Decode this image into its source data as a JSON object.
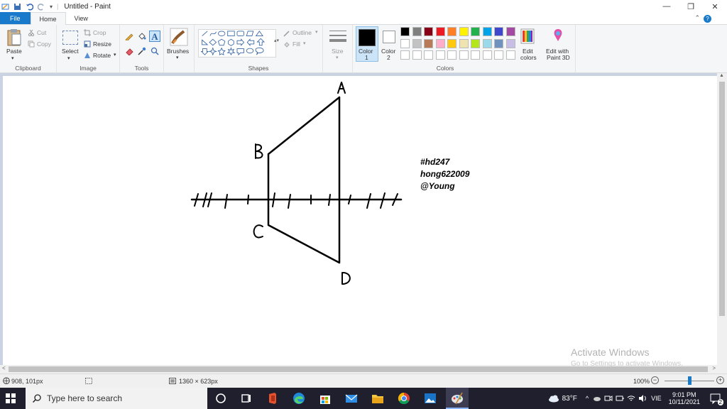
{
  "window": {
    "title": "Untitled - Paint",
    "controls": [
      "minimize",
      "maximize",
      "close"
    ]
  },
  "tabs": {
    "file": "File",
    "home": "Home",
    "view": "View"
  },
  "ribbon": {
    "clipboard": {
      "label": "Clipboard",
      "paste": "Paste",
      "cut": "Cut",
      "copy": "Copy"
    },
    "image": {
      "label": "Image",
      "select": "Select",
      "crop": "Crop",
      "resize": "Resize",
      "rotate": "Rotate"
    },
    "tools": {
      "label": "Tools"
    },
    "brushes": {
      "label": "Brushes"
    },
    "shapes": {
      "label": "Shapes",
      "outline": "Outline",
      "fill": "Fill"
    },
    "size": {
      "label": "Size"
    },
    "colors": {
      "label": "Colors",
      "color1": "Color",
      "color1_num": "1",
      "color2": "Color",
      "color2_num": "2",
      "edit_colors_1": "Edit",
      "edit_colors_2": "colors",
      "edit_3d_1": "Edit with",
      "edit_3d_2": "Paint 3D",
      "color1_value": "#000000",
      "color2_value": "#ffffff",
      "palette_row1": [
        "#000000",
        "#7f7f7f",
        "#880015",
        "#ed1c24",
        "#ff7f27",
        "#fff200",
        "#22b14c",
        "#00a2e8",
        "#3f48cc",
        "#a349a4"
      ],
      "palette_row2": [
        "#ffffff",
        "#c3c3c3",
        "#b97a57",
        "#ffaec9",
        "#ffc90e",
        "#efe4b0",
        "#b5e61d",
        "#99d9ea",
        "#7092be",
        "#c8bfe7"
      ],
      "palette_row3": [
        "#ffffff",
        "#ffffff",
        "#ffffff",
        "#ffffff",
        "#ffffff",
        "#ffffff",
        "#ffffff",
        "#ffffff",
        "#ffffff",
        "#ffffff"
      ]
    }
  },
  "canvas": {
    "labels": {
      "A": "A",
      "B": "B",
      "C": "C",
      "D": "D"
    },
    "notes": [
      "#hd247",
      "hong622009",
      "@Young"
    ]
  },
  "watermark": {
    "line1": "Activate Windows",
    "line2": "Go to Settings to activate Windows."
  },
  "status": {
    "cursor_pos": "908, 101px",
    "canvas_size": "1360 × 623px",
    "zoom": "100%",
    "zoom_fraction": 0.5
  },
  "taskbar": {
    "search_placeholder": "Type here to search",
    "weather": "83°F",
    "language": "VIE",
    "time": "9:01 PM",
    "date": "10/11/2021",
    "notifications": "2"
  }
}
